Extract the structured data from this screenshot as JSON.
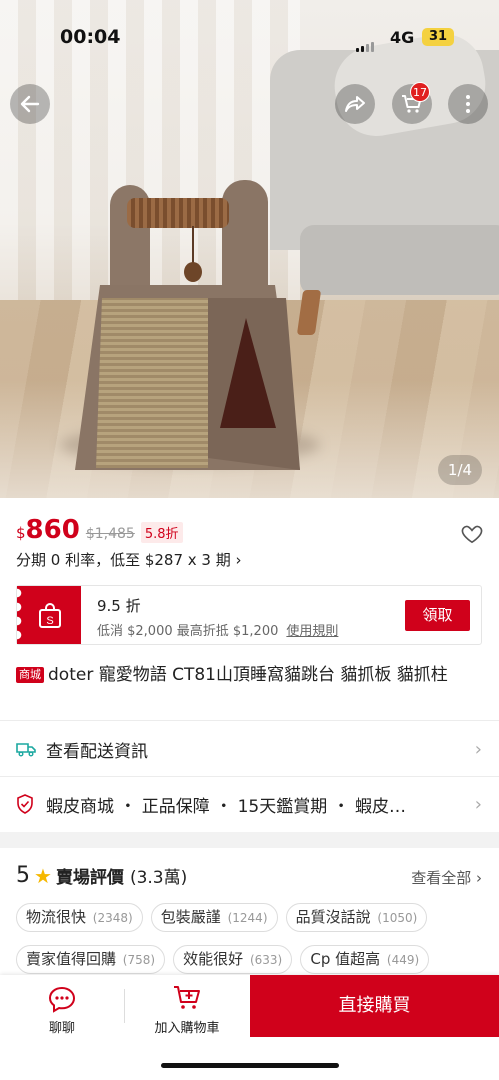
{
  "status_bar": {
    "time": "00:04",
    "network": "4G",
    "battery": "31"
  },
  "gallery": {
    "counter": "1/4",
    "cart_badge": "17"
  },
  "price": {
    "currency": "$",
    "current": "860",
    "original": "$1,485",
    "discount": "5.8折",
    "installment": "分期 0 利率，低至 $287 x 3 期 ›"
  },
  "voucher": {
    "title": "9.5 折",
    "desc": "低消 $2,000 最高折抵 $1,200",
    "rule": "使用規則",
    "claim": "領取",
    "icon_letter": "S"
  },
  "product": {
    "mall_tag": "商城",
    "title": "doter 寵愛物語 CT81山頂睡窩貓跳台 貓抓板 貓抓柱"
  },
  "shipping": {
    "label": "查看配送資訊"
  },
  "guarantee": {
    "label": "蝦皮商城 ・ 正品保障 ・ 15天鑑賞期 ・ 蝦皮…"
  },
  "reviews": {
    "rating": "5",
    "label": "賣場評價",
    "count": "(3.3萬)",
    "see_all": "查看全部",
    "tags": [
      {
        "text": "物流很快",
        "count": "(2348)"
      },
      {
        "text": "包裝嚴謹",
        "count": "(1244)"
      },
      {
        "text": "品質沒話說",
        "count": "(1050)"
      },
      {
        "text": "賣家值得回購",
        "count": "(758)"
      },
      {
        "text": "效能很好",
        "count": "(633)"
      },
      {
        "text": "Cp 值超高",
        "count": "(449)"
      }
    ]
  },
  "bottom_bar": {
    "chat": "聊聊",
    "add_cart": "加入購物車",
    "buy_now": "直接購買"
  },
  "colors": {
    "brand_red": "#d0011b",
    "star": "#f6b800"
  }
}
